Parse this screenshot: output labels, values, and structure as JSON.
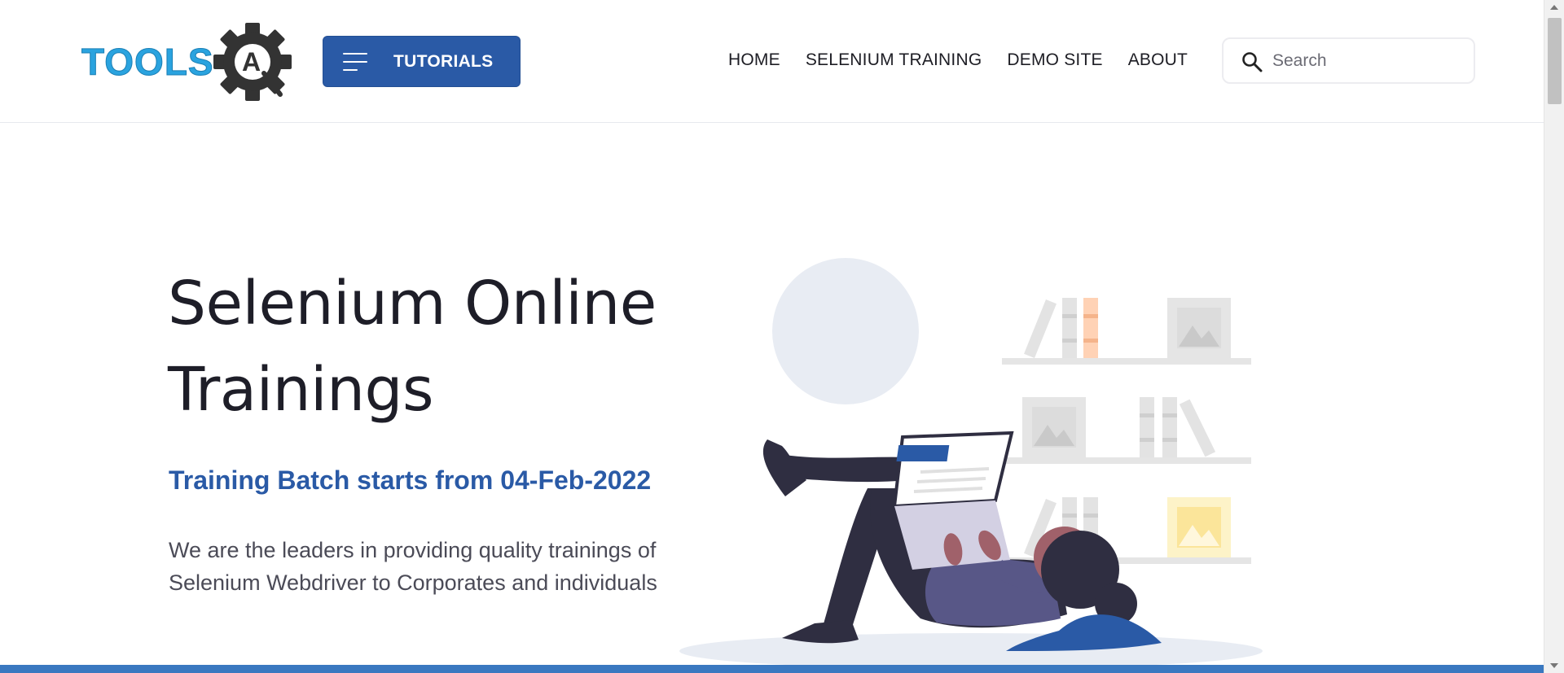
{
  "header": {
    "logo_text": "TOOLSQA",
    "tutorials_label": "TUTORIALS",
    "nav": [
      "HOME",
      "SELENIUM TRAINING",
      "DEMO SITE",
      "ABOUT"
    ],
    "search": {
      "placeholder": "Search",
      "value": ""
    }
  },
  "hero": {
    "title_line1": "Selenium Online",
    "title_line2": "Trainings",
    "subtitle": "Training Batch starts from 04-Feb-2022",
    "description": "We are the leaders in providing quality trainings of Selenium Webdriver to Corporates and individuals"
  },
  "icons": [
    "toolsqa-logo",
    "hamburger-menu-icon",
    "search-icon",
    "scroll-up-icon",
    "scroll-down-icon"
  ],
  "colors": {
    "brand_blue": "#2a5aa6",
    "logo_cyan": "#2aa3df",
    "gear_dark": "#333333",
    "text_dark": "#1e1e28",
    "text_muted": "#4b4b57"
  }
}
